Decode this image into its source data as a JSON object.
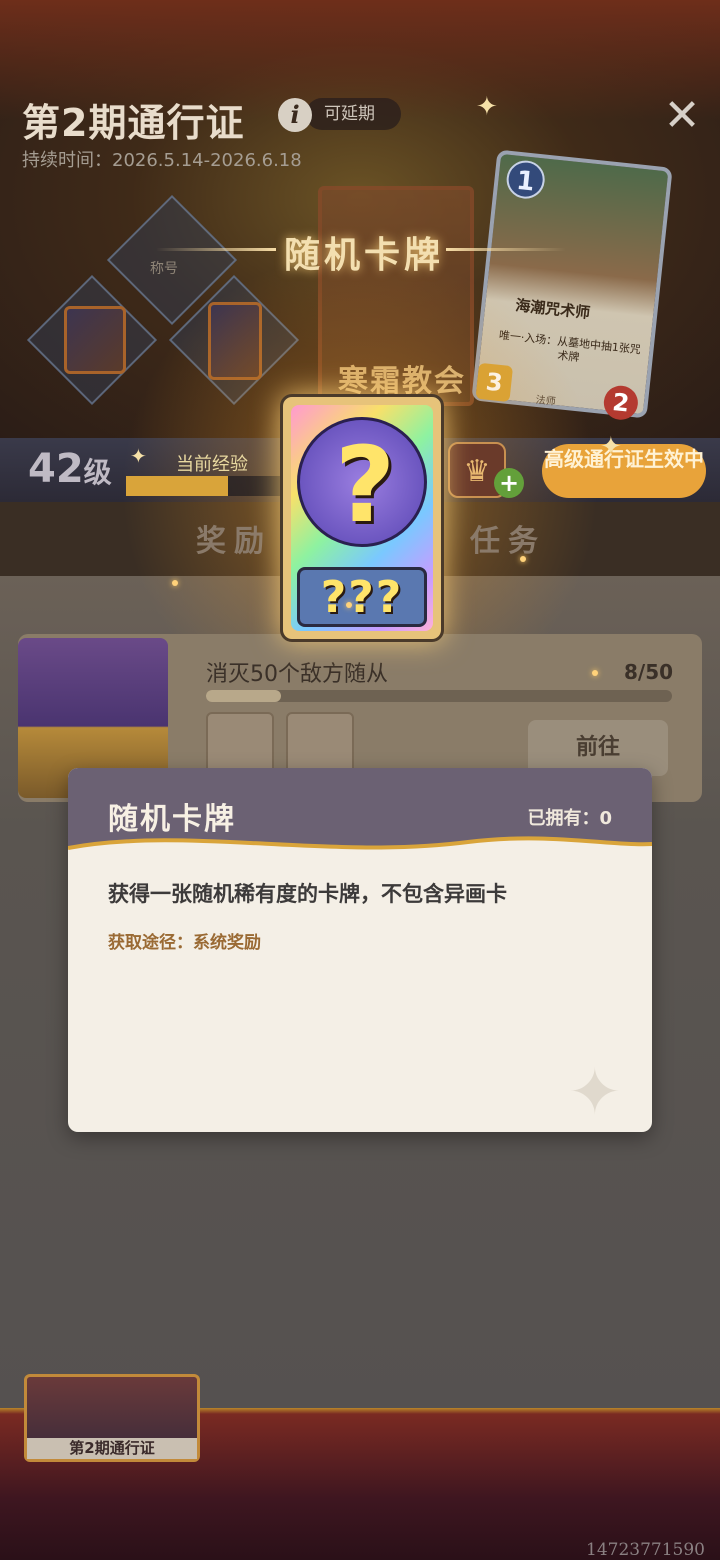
{
  "header": {
    "title": "第2期通行证",
    "info_icon": "i",
    "extendable_label": "可延期",
    "duration": "持续时间：2026.5.14-2026.6.18",
    "close_icon": "✕"
  },
  "background": {
    "card_title_overlay": "随机卡牌",
    "title_reward_label": "称号",
    "faded_card_label": "寒霜教会",
    "big_card": {
      "cost": "1",
      "name": "海潮咒术师",
      "desc": "唯一·入场：从墓地中抽1张咒术牌",
      "attack": "3",
      "health": "2",
      "footer": "法师"
    }
  },
  "level_bar": {
    "level": "42",
    "level_unit": "级",
    "exp_label": "当前经验",
    "exp_fraction": 0.34,
    "crown_icon": "♛",
    "plus_icon": "+",
    "premium_button": "高级通行证生效中"
  },
  "tabs": {
    "rewards": "奖励",
    "tasks": "任务"
  },
  "task": {
    "name": "消灭50个敌方随从",
    "progress_text": "8/50",
    "progress_fraction": 0.16,
    "go_button": "前往"
  },
  "featured_card": {
    "symbol": "?",
    "plate": "???"
  },
  "popup": {
    "title": "随机卡牌",
    "owned": "已拥有：0",
    "description": "获得一张随机稀有度的卡牌，不包含异画卡",
    "source": "获取途径：系统奖励",
    "sparkle_icon": "✦"
  },
  "bottom_tab": {
    "label": "第2期通行证"
  },
  "watermark": "14723771590",
  "colors": {
    "gold": "#e8a33a",
    "popup_header": "#6b6173",
    "popup_source": "#9a6a34",
    "popup_bg": "#f4efe6"
  }
}
